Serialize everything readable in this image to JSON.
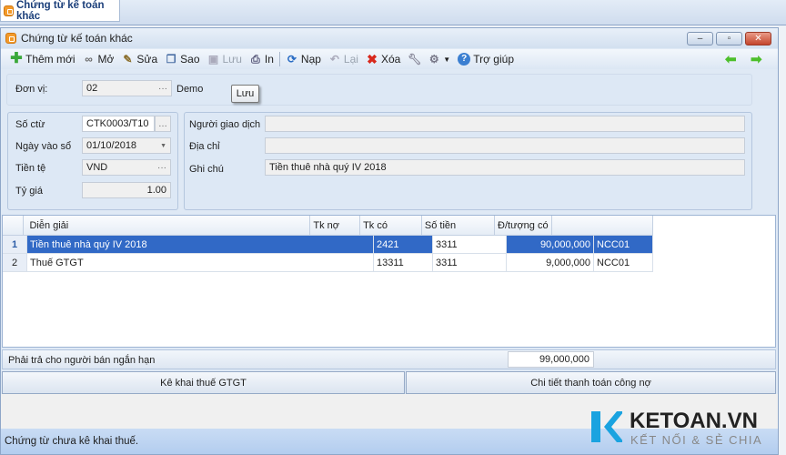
{
  "tab": {
    "title": "Chứng từ kế toán khác"
  },
  "window": {
    "title": "Chứng từ kế toán khác",
    "minimize": "–",
    "restore": "▫",
    "close": "✕"
  },
  "toolbar": {
    "new": "Thêm mới",
    "open": "Mở",
    "edit": "Sửa",
    "copy": "Sao",
    "save": "Lưu",
    "print": "In",
    "reload": "Nạp",
    "undo": "Lại",
    "delete": "Xóa",
    "help": "Trợ giúp"
  },
  "tooltip": "Lưu",
  "unit": {
    "label": "Đơn vị:",
    "value": "02",
    "name": "Demo"
  },
  "voucher": {
    "no_label": "Số ctừ",
    "no_value": "CTK0003/T10",
    "date_label": "Ngày vào sổ",
    "date_value": "01/10/2018",
    "currency_label": "Tiền tệ",
    "currency_value": "VND",
    "rate_label": "Tỷ giá",
    "rate_value": "1.00"
  },
  "partner": {
    "person_label": "Người giao dịch",
    "person_value": "",
    "address_label": "Địa chỉ",
    "address_value": "",
    "note_label": "Ghi chú",
    "note_value": "Tiền thuê nhà quý IV 2018"
  },
  "grid": {
    "headers": [
      "Diễn giải",
      "Tk nợ",
      "Tk có",
      "Số tiền",
      "Đ/tượng có"
    ],
    "rows": [
      {
        "n": "1",
        "desc": "Tiền thuê nhà quý IV 2018",
        "debit": "2421",
        "credit": "3311",
        "amount": "90,000,000",
        "obj": "NCC01"
      },
      {
        "n": "2",
        "desc": "Thuế GTGT",
        "debit": "13311",
        "credit": "3311",
        "amount": "9,000,000",
        "obj": "NCC01"
      }
    ]
  },
  "summary": {
    "label": "Phải trả cho người bán ngắn hạn",
    "value": "99,000,000"
  },
  "buttons": {
    "vat": "Kê khai thuế GTGT",
    "payment": "Chi tiết thanh toán công nợ"
  },
  "status": "Chứng từ chưa kê khai thuế.",
  "logo": {
    "brand": "KETOAN.VN",
    "slogan": "KẾT NỐI & SẺ CHIA"
  }
}
